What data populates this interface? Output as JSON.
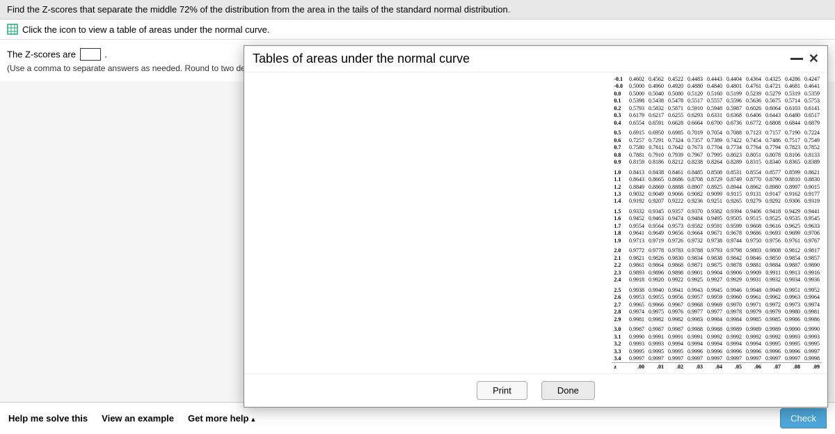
{
  "topbar": {
    "question": "Find the Z-scores that separate the middle 72% of the distribution from the area in the tails of the standard normal distribution."
  },
  "instruction": {
    "link_text": "Click the icon to view a table of areas under the normal curve."
  },
  "answer": {
    "prefix": "The Z-scores are ",
    "suffix": ".",
    "hint": "(Use a comma to separate answers as needed. Round to two decimal places as needed.)"
  },
  "bottom": {
    "help": "Help me solve this",
    "example": "View an example",
    "more": "Get more help",
    "check": "Check"
  },
  "modal": {
    "title": "Tables of areas under the normal curve",
    "print": "Print",
    "done": "Done"
  },
  "z_table": {
    "col_headers": [
      ".00",
      ".01",
      ".02",
      ".03",
      ".04",
      ".05",
      ".06",
      ".07",
      ".08",
      ".09"
    ],
    "blocks": [
      {
        "rows": [
          {
            "z": "-0.1",
            "v": [
              "0.4602",
              "0.4562",
              "0.4522",
              "0.4483",
              "0.4443",
              "0.4404",
              "0.4364",
              "0.4325",
              "0.4286",
              "0.4247"
            ]
          },
          {
            "z": "-0.0",
            "v": [
              "0.5000",
              "0.4960",
              "0.4920",
              "0.4880",
              "0.4840",
              "0.4801",
              "0.4761",
              "0.4721",
              "0.4681",
              "0.4641"
            ]
          },
          {
            "z": "0.0",
            "v": [
              "0.5000",
              "0.5040",
              "0.5080",
              "0.5120",
              "0.5160",
              "0.5199",
              "0.5239",
              "0.5279",
              "0.5319",
              "0.5359"
            ]
          },
          {
            "z": "0.1",
            "v": [
              "0.5398",
              "0.5438",
              "0.5478",
              "0.5517",
              "0.5557",
              "0.5596",
              "0.5636",
              "0.5675",
              "0.5714",
              "0.5753"
            ]
          },
          {
            "z": "0.2",
            "v": [
              "0.5793",
              "0.5832",
              "0.5871",
              "0.5910",
              "0.5948",
              "0.5987",
              "0.6026",
              "0.6064",
              "0.6103",
              "0.6141"
            ]
          },
          {
            "z": "0.3",
            "v": [
              "0.6179",
              "0.6217",
              "0.6255",
              "0.6293",
              "0.6331",
              "0.6368",
              "0.6406",
              "0.6443",
              "0.6480",
              "0.6517"
            ]
          },
          {
            "z": "0.4",
            "v": [
              "0.6554",
              "0.6591",
              "0.6628",
              "0.6664",
              "0.6700",
              "0.6736",
              "0.6772",
              "0.6808",
              "0.6844",
              "0.6879"
            ]
          }
        ]
      },
      {
        "rows": [
          {
            "z": "0.5",
            "v": [
              "0.6915",
              "0.6950",
              "0.6985",
              "0.7019",
              "0.7054",
              "0.7088",
              "0.7123",
              "0.7157",
              "0.7190",
              "0.7224"
            ]
          },
          {
            "z": "0.6",
            "v": [
              "0.7257",
              "0.7291",
              "0.7324",
              "0.7357",
              "0.7389",
              "0.7422",
              "0.7454",
              "0.7486",
              "0.7517",
              "0.7549"
            ]
          },
          {
            "z": "0.7",
            "v": [
              "0.7580",
              "0.7611",
              "0.7642",
              "0.7673",
              "0.7704",
              "0.7734",
              "0.7764",
              "0.7794",
              "0.7823",
              "0.7852"
            ]
          },
          {
            "z": "0.8",
            "v": [
              "0.7881",
              "0.7910",
              "0.7939",
              "0.7967",
              "0.7995",
              "0.8023",
              "0.8051",
              "0.8078",
              "0.8106",
              "0.8133"
            ]
          },
          {
            "z": "0.9",
            "v": [
              "0.8159",
              "0.8186",
              "0.8212",
              "0.8238",
              "0.8264",
              "0.8289",
              "0.8315",
              "0.8340",
              "0.8365",
              "0.8389"
            ]
          }
        ]
      },
      {
        "rows": [
          {
            "z": "1.0",
            "v": [
              "0.8413",
              "0.8438",
              "0.8461",
              "0.8485",
              "0.8508",
              "0.8531",
              "0.8554",
              "0.8577",
              "0.8599",
              "0.8621"
            ]
          },
          {
            "z": "1.1",
            "v": [
              "0.8643",
              "0.8665",
              "0.8686",
              "0.8708",
              "0.8729",
              "0.8749",
              "0.8770",
              "0.8790",
              "0.8810",
              "0.8830"
            ]
          },
          {
            "z": "1.2",
            "v": [
              "0.8849",
              "0.8869",
              "0.8888",
              "0.8907",
              "0.8925",
              "0.8944",
              "0.8962",
              "0.8980",
              "0.8997",
              "0.9015"
            ]
          },
          {
            "z": "1.3",
            "v": [
              "0.9032",
              "0.9049",
              "0.9066",
              "0.9082",
              "0.9099",
              "0.9115",
              "0.9131",
              "0.9147",
              "0.9162",
              "0.9177"
            ]
          },
          {
            "z": "1.4",
            "v": [
              "0.9192",
              "0.9207",
              "0.9222",
              "0.9236",
              "0.9251",
              "0.9265",
              "0.9279",
              "0.9292",
              "0.9306",
              "0.9319"
            ]
          }
        ]
      },
      {
        "rows": [
          {
            "z": "1.5",
            "v": [
              "0.9332",
              "0.9345",
              "0.9357",
              "0.9370",
              "0.9382",
              "0.9394",
              "0.9406",
              "0.9418",
              "0.9429",
              "0.9441"
            ]
          },
          {
            "z": "1.6",
            "v": [
              "0.9452",
              "0.9463",
              "0.9474",
              "0.9484",
              "0.9495",
              "0.9505",
              "0.9515",
              "0.9525",
              "0.9535",
              "0.9545"
            ]
          },
          {
            "z": "1.7",
            "v": [
              "0.9554",
              "0.9564",
              "0.9573",
              "0.9582",
              "0.9591",
              "0.9599",
              "0.9608",
              "0.9616",
              "0.9625",
              "0.9633"
            ]
          },
          {
            "z": "1.8",
            "v": [
              "0.9641",
              "0.9649",
              "0.9656",
              "0.9664",
              "0.9671",
              "0.9678",
              "0.9686",
              "0.9693",
              "0.9699",
              "0.9706"
            ]
          },
          {
            "z": "1.9",
            "v": [
              "0.9713",
              "0.9719",
              "0.9726",
              "0.9732",
              "0.9738",
              "0.9744",
              "0.9750",
              "0.9756",
              "0.9761",
              "0.9767"
            ]
          }
        ]
      },
      {
        "rows": [
          {
            "z": "2.0",
            "v": [
              "0.9772",
              "0.9778",
              "0.9783",
              "0.9788",
              "0.9793",
              "0.9798",
              "0.9803",
              "0.9808",
              "0.9812",
              "0.9817"
            ]
          },
          {
            "z": "2.1",
            "v": [
              "0.9821",
              "0.9826",
              "0.9830",
              "0.9834",
              "0.9838",
              "0.9842",
              "0.9846",
              "0.9850",
              "0.9854",
              "0.9857"
            ]
          },
          {
            "z": "2.2",
            "v": [
              "0.9861",
              "0.9864",
              "0.9868",
              "0.9871",
              "0.9875",
              "0.9878",
              "0.9881",
              "0.9884",
              "0.9887",
              "0.9890"
            ]
          },
          {
            "z": "2.3",
            "v": [
              "0.9893",
              "0.9896",
              "0.9898",
              "0.9901",
              "0.9904",
              "0.9906",
              "0.9909",
              "0.9911",
              "0.9913",
              "0.9916"
            ]
          },
          {
            "z": "2.4",
            "v": [
              "0.9918",
              "0.9920",
              "0.9922",
              "0.9925",
              "0.9927",
              "0.9929",
              "0.9931",
              "0.9932",
              "0.9934",
              "0.9936"
            ]
          }
        ]
      },
      {
        "rows": [
          {
            "z": "2.5",
            "v": [
              "0.9938",
              "0.9940",
              "0.9941",
              "0.9943",
              "0.9945",
              "0.9946",
              "0.9948",
              "0.9949",
              "0.9951",
              "0.9952"
            ]
          },
          {
            "z": "2.6",
            "v": [
              "0.9953",
              "0.9955",
              "0.9956",
              "0.9957",
              "0.9959",
              "0.9960",
              "0.9961",
              "0.9962",
              "0.9963",
              "0.9964"
            ]
          },
          {
            "z": "2.7",
            "v": [
              "0.9965",
              "0.9966",
              "0.9967",
              "0.9968",
              "0.9969",
              "0.9970",
              "0.9971",
              "0.9972",
              "0.9973",
              "0.9974"
            ]
          },
          {
            "z": "2.8",
            "v": [
              "0.9974",
              "0.9975",
              "0.9976",
              "0.9977",
              "0.9977",
              "0.9978",
              "0.9979",
              "0.9979",
              "0.9980",
              "0.9981"
            ]
          },
          {
            "z": "2.9",
            "v": [
              "0.9981",
              "0.9982",
              "0.9982",
              "0.9983",
              "0.9984",
              "0.9984",
              "0.9985",
              "0.9985",
              "0.9986",
              "0.9986"
            ]
          }
        ]
      },
      {
        "rows": [
          {
            "z": "3.0",
            "v": [
              "0.9987",
              "0.9987",
              "0.9987",
              "0.9988",
              "0.9988",
              "0.9989",
              "0.9989",
              "0.9989",
              "0.9990",
              "0.9990"
            ]
          },
          {
            "z": "3.1",
            "v": [
              "0.9990",
              "0.9991",
              "0.9991",
              "0.9991",
              "0.9992",
              "0.9992",
              "0.9992",
              "0.9992",
              "0.9993",
              "0.9993"
            ]
          },
          {
            "z": "3.2",
            "v": [
              "0.9993",
              "0.9993",
              "0.9994",
              "0.9994",
              "0.9994",
              "0.9994",
              "0.9994",
              "0.9995",
              "0.9995",
              "0.9995"
            ]
          },
          {
            "z": "3.3",
            "v": [
              "0.9995",
              "0.9995",
              "0.9995",
              "0.9996",
              "0.9996",
              "0.9996",
              "0.9996",
              "0.9996",
              "0.9996",
              "0.9997"
            ]
          },
          {
            "z": "3.4",
            "v": [
              "0.9997",
              "0.9997",
              "0.9997",
              "0.9997",
              "0.9997",
              "0.9997",
              "0.9997",
              "0.9997",
              "0.9997",
              "0.9998"
            ]
          }
        ]
      }
    ],
    "footer_label": "z"
  }
}
